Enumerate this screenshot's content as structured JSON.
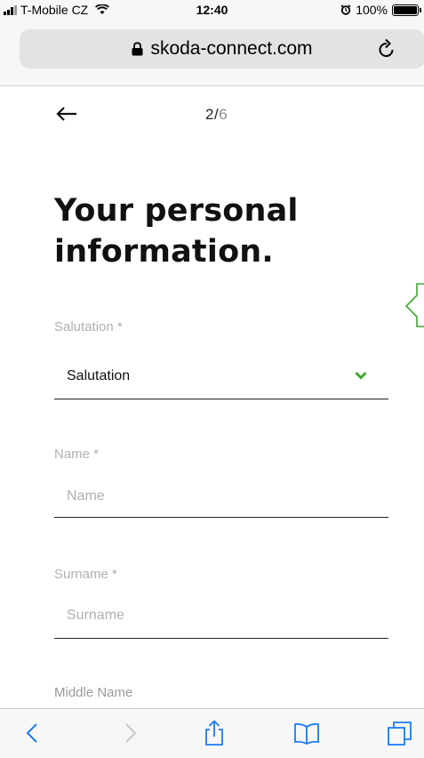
{
  "status_bar": {
    "carrier": "T-Mobile CZ",
    "time": "12:40",
    "battery": "100%",
    "signal_icon": "signal-icon",
    "wifi_icon": "wifi-icon",
    "alarm_icon": "alarm-icon",
    "battery_icon": "battery-icon"
  },
  "browser": {
    "url": "skoda-connect.com",
    "lock_icon": "lock-icon",
    "reload_icon": "reload-icon"
  },
  "page": {
    "step_current": "2",
    "step_separator": "/",
    "step_total": "6",
    "title": "Your personal information.",
    "fields": [
      {
        "label": "Salutation *",
        "value": "Salutation"
      },
      {
        "label": "Name *",
        "placeholder": "Name"
      },
      {
        "label": "Surname *",
        "placeholder": "Surname"
      },
      {
        "label": "Middle Name"
      }
    ]
  },
  "toolbar": {
    "buttons": [
      "back-icon",
      "forward-icon",
      "share-icon",
      "bookmarks-icon",
      "tabs-icon"
    ]
  },
  "colors": {
    "accent_green": "#3ea92f",
    "label_gray": "#b0b0b0",
    "ios_blue": "#1a7cf5"
  }
}
